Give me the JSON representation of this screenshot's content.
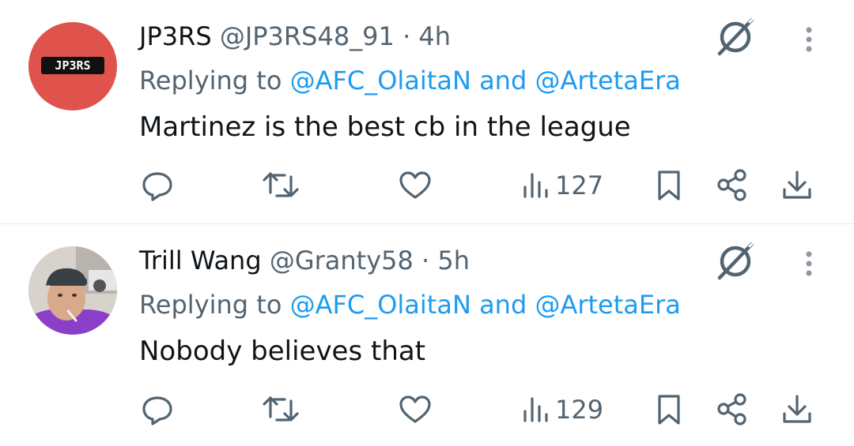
{
  "tweets": [
    {
      "display_name": "JP3RS",
      "handle": "@JP3RS48_91",
      "separator": "·",
      "time": "4h",
      "reply_prefix": "Replying to",
      "reply_mention_1": "@AFC_OlaitaN",
      "reply_and": "and",
      "reply_mention_2": "@ArtetaEra",
      "text": "Martinez is the best cb in the league",
      "views": "127",
      "avatar_text": "JP3RS",
      "avatar_color": "#e0524c"
    },
    {
      "display_name": "Trill Wang",
      "handle": "@Granty58",
      "separator": "·",
      "time": "5h",
      "reply_prefix": "Replying to",
      "reply_mention_1": "@AFC_OlaitaN",
      "reply_and": "and",
      "reply_mention_2": "@ArtetaEra",
      "text": "Nobody believes that",
      "views": "129",
      "avatar_color": "#8a3fc4"
    }
  ],
  "icons": [
    "grok-icon",
    "more-vertical-icon",
    "reply-icon",
    "retweet-icon",
    "like-icon",
    "views-icon",
    "bookmark-icon",
    "share-icon",
    "download-icon"
  ],
  "colors": {
    "link": "#1d9bf0",
    "muted": "#536471",
    "text": "#0f1419",
    "divider": "#e6e8ea"
  }
}
